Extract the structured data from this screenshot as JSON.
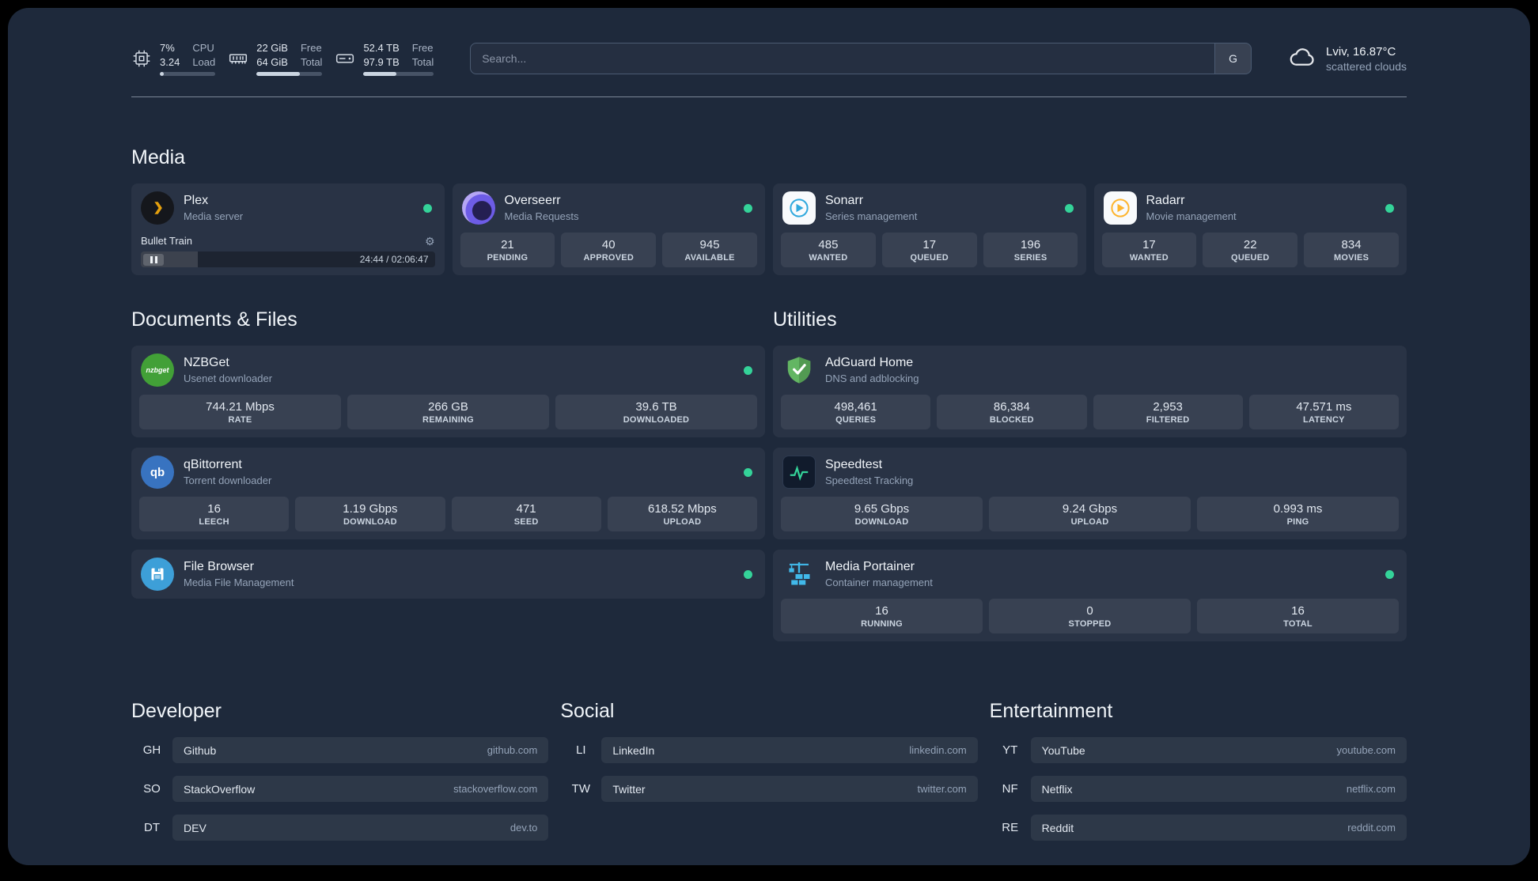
{
  "topbar": {
    "cpu": {
      "usage": "7%",
      "load": "3.24",
      "label_top": "CPU",
      "label_bottom": "Load",
      "progress_pct": 7
    },
    "memory": {
      "free": "22 GiB",
      "total": "64 GiB",
      "label_top": "Free",
      "label_bottom": "Total",
      "progress_pct": 66
    },
    "disk": {
      "free": "52.4 TB",
      "total": "97.9 TB",
      "label_top": "Free",
      "label_bottom": "Total",
      "progress_pct": 47
    },
    "search": {
      "placeholder": "Search...",
      "provider_label": "G"
    },
    "weather": {
      "location": "Lviv, 16.87°C",
      "condition": "scattered clouds"
    }
  },
  "sections": {
    "media": {
      "title": "Media"
    },
    "documents": {
      "title": "Documents & Files"
    },
    "utilities": {
      "title": "Utilities"
    }
  },
  "services": {
    "plex": {
      "title": "Plex",
      "subtitle": "Media server",
      "now_playing": "Bullet Train",
      "time": "24:44 / 02:06:47",
      "progress_pct": 19.5
    },
    "overseerr": {
      "title": "Overseerr",
      "subtitle": "Media Requests",
      "stats": [
        {
          "value": "21",
          "label": "PENDING"
        },
        {
          "value": "40",
          "label": "APPROVED"
        },
        {
          "value": "945",
          "label": "AVAILABLE"
        }
      ]
    },
    "sonarr": {
      "title": "Sonarr",
      "subtitle": "Series management",
      "stats": [
        {
          "value": "485",
          "label": "WANTED"
        },
        {
          "value": "17",
          "label": "QUEUED"
        },
        {
          "value": "196",
          "label": "SERIES"
        }
      ]
    },
    "radarr": {
      "title": "Radarr",
      "subtitle": "Movie management",
      "stats": [
        {
          "value": "17",
          "label": "WANTED"
        },
        {
          "value": "22",
          "label": "QUEUED"
        },
        {
          "value": "834",
          "label": "MOVIES"
        }
      ]
    },
    "nzbget": {
      "title": "NZBGet",
      "subtitle": "Usenet downloader",
      "icon_text": "nzbget",
      "stats": [
        {
          "value": "744.21 Mbps",
          "label": "RATE"
        },
        {
          "value": "266 GB",
          "label": "REMAINING"
        },
        {
          "value": "39.6 TB",
          "label": "DOWNLOADED"
        }
      ]
    },
    "qbittorrent": {
      "title": "qBittorrent",
      "subtitle": "Torrent downloader",
      "icon_text": "qb",
      "stats": [
        {
          "value": "16",
          "label": "LEECH"
        },
        {
          "value": "1.19 Gbps",
          "label": "DOWNLOAD"
        },
        {
          "value": "471",
          "label": "SEED"
        },
        {
          "value": "618.52 Mbps",
          "label": "UPLOAD"
        }
      ]
    },
    "filebrowser": {
      "title": "File Browser",
      "subtitle": "Media File Management"
    },
    "adguard": {
      "title": "AdGuard Home",
      "subtitle": "DNS and adblocking",
      "stats": [
        {
          "value": "498,461",
          "label": "QUERIES"
        },
        {
          "value": "86,384",
          "label": "BLOCKED"
        },
        {
          "value": "2,953",
          "label": "FILTERED"
        },
        {
          "value": "47.571 ms",
          "label": "LATENCY"
        }
      ]
    },
    "speedtest": {
      "title": "Speedtest",
      "subtitle": "Speedtest Tracking",
      "stats": [
        {
          "value": "9.65 Gbps",
          "label": "DOWNLOAD"
        },
        {
          "value": "9.24 Gbps",
          "label": "UPLOAD"
        },
        {
          "value": "0.993 ms",
          "label": "PING"
        }
      ]
    },
    "portainer": {
      "title": "Media Portainer",
      "subtitle": "Container management",
      "stats": [
        {
          "value": "16",
          "label": "RUNNING"
        },
        {
          "value": "0",
          "label": "STOPPED"
        },
        {
          "value": "16",
          "label": "TOTAL"
        }
      ]
    }
  },
  "bookmarks": {
    "developer": {
      "title": "Developer",
      "items": [
        {
          "abbr": "GH",
          "name": "Github",
          "domain": "github.com"
        },
        {
          "abbr": "SO",
          "name": "StackOverflow",
          "domain": "stackoverflow.com"
        },
        {
          "abbr": "DT",
          "name": "DEV",
          "domain": "dev.to"
        }
      ]
    },
    "social": {
      "title": "Social",
      "items": [
        {
          "abbr": "LI",
          "name": "LinkedIn",
          "domain": "linkedin.com"
        },
        {
          "abbr": "TW",
          "name": "Twitter",
          "domain": "twitter.com"
        }
      ]
    },
    "entertainment": {
      "title": "Entertainment",
      "items": [
        {
          "abbr": "YT",
          "name": "YouTube",
          "domain": "youtube.com"
        },
        {
          "abbr": "NF",
          "name": "Netflix",
          "domain": "netflix.com"
        },
        {
          "abbr": "RE",
          "name": "Reddit",
          "domain": "reddit.com"
        }
      ]
    }
  },
  "colors": {
    "status_online": "#34d399",
    "plex_accent": "#e5a00d",
    "sonarr_accent": "#2fa8dd",
    "radarr_accent": "#fdb52f",
    "nzbget_accent": "#42a037",
    "qbittorrent_accent": "#3873c0",
    "filebrowser_accent": "#3d9fd8",
    "adguard_accent": "#63b663",
    "speedtest_accent": "#34d399",
    "portainer_accent": "#41b9ea",
    "background": "#1e293b"
  }
}
